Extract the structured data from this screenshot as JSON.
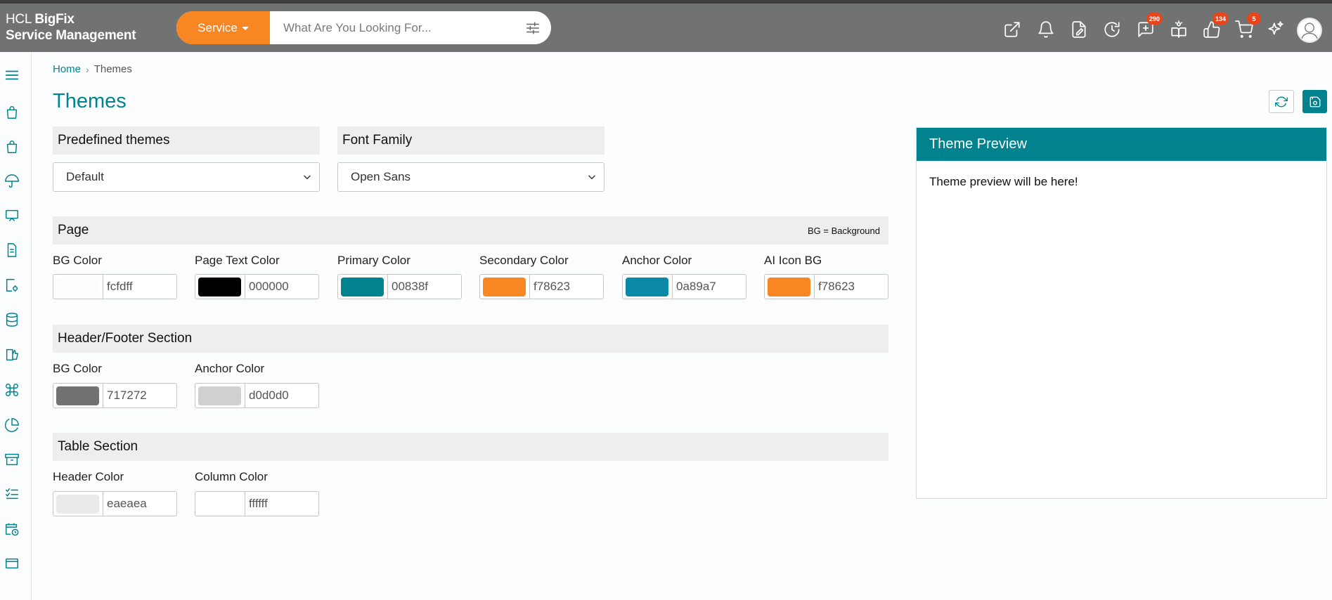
{
  "app": {
    "logo_line1_a": "HCL ",
    "logo_line1_b": "BigFix",
    "logo_line2": "Service Management"
  },
  "header": {
    "service_label": "Service",
    "search_placeholder": "What Are You Looking For...",
    "icons": [
      {
        "name": "external-link-icon",
        "badge": null
      },
      {
        "name": "bell-icon",
        "badge": null
      },
      {
        "name": "file-edit-icon",
        "badge": null
      },
      {
        "name": "clock-icon",
        "badge": null
      },
      {
        "name": "chat-plus-icon",
        "badge": "290"
      },
      {
        "name": "book-bulb-icon",
        "badge": null
      },
      {
        "name": "thumbs-up-icon",
        "badge": "134"
      },
      {
        "name": "cart-icon",
        "badge": "5"
      },
      {
        "name": "sparkle-icon",
        "badge": null
      }
    ]
  },
  "breadcrumb": {
    "home": "Home",
    "current": "Themes"
  },
  "page": {
    "title": "Themes"
  },
  "predefined": {
    "label": "Predefined themes",
    "selected": "Default"
  },
  "font_family": {
    "label": "Font Family",
    "selected": "Open Sans"
  },
  "sections": {
    "page": {
      "title": "Page",
      "note": "BG = Background",
      "fields": [
        {
          "label": "BG Color",
          "value": "fcfdff",
          "color": "#fcfdff"
        },
        {
          "label": "Page Text Color",
          "value": "000000",
          "color": "#000000"
        },
        {
          "label": "Primary Color",
          "value": "00838f",
          "color": "#00838f"
        },
        {
          "label": "Secondary Color",
          "value": "f78623",
          "color": "#f78623"
        },
        {
          "label": "Anchor Color",
          "value": "0a89a7",
          "color": "#0a89a7"
        },
        {
          "label": "AI Icon BG",
          "value": "f78623",
          "color": "#f78623"
        }
      ]
    },
    "header_footer": {
      "title": "Header/Footer Section",
      "fields": [
        {
          "label": "BG Color",
          "value": "717272",
          "color": "#717272"
        },
        {
          "label": "Anchor Color",
          "value": "d0d0d0",
          "color": "#d0d0d0"
        }
      ]
    },
    "table": {
      "title": "Table Section",
      "fields": [
        {
          "label": "Header Color",
          "value": "eaeaea",
          "color": "#eaeaea"
        },
        {
          "label": "Column Color",
          "value": "ffffff",
          "color": "#ffffff"
        }
      ]
    }
  },
  "preview": {
    "title": "Theme Preview",
    "body": "Theme preview will be here!"
  },
  "colors": {
    "primary": "#00838f",
    "secondary": "#f78623",
    "header_bg": "#717272"
  }
}
